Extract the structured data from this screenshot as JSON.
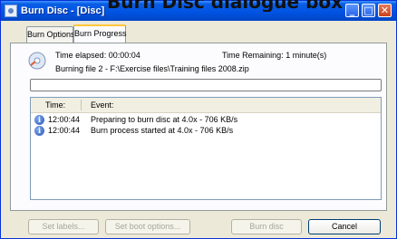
{
  "caption": "Burn Disc dialogue box",
  "window": {
    "title": "Burn Disc - [Disc]",
    "controls": {
      "minimize": "_",
      "maximize": "□",
      "close": "✕"
    }
  },
  "tabs": [
    {
      "label": "Burn Options",
      "active": false
    },
    {
      "label": "Burn Progress",
      "active": true
    }
  ],
  "status": {
    "elapsed": "Time elapsed: 00:00:04",
    "remaining": "Time Remaining: 1 minute(s)",
    "burning_file": "Burning file 2 - F:\\Exercise files\\Training files 2008.zip",
    "progress_fraction": 0.0
  },
  "events": {
    "columns": {
      "time": "Time:",
      "event": "Event:"
    },
    "rows": [
      {
        "icon": "info-icon",
        "time": "12:00:44",
        "event": "Preparing to burn disc at 4.0x - 706 KB/s"
      },
      {
        "icon": "info-icon",
        "time": "12:00:44",
        "event": "Burn process started at 4.0x - 706 KB/s"
      }
    ]
  },
  "buttons": {
    "set_labels": "Set labels...",
    "set_boot_options": "Set boot options...",
    "burn_disc": "Burn disc",
    "cancel": "Cancel"
  },
  "colors": {
    "title_bar": "#0054e3",
    "progress_fill": "#2bc22b",
    "dialog_bg": "#ece9d8"
  }
}
